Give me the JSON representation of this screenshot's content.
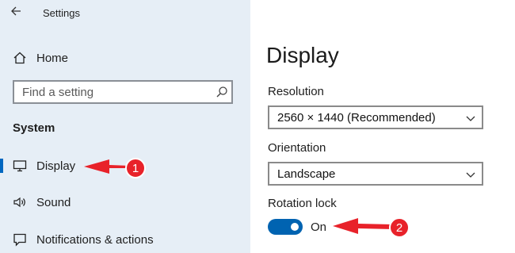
{
  "window": {
    "title": "Settings"
  },
  "sidebar": {
    "home_label": "Home",
    "search": {
      "placeholder": "Find a setting"
    },
    "section_title": "System",
    "items": [
      {
        "label": "Display",
        "icon": "monitor-icon",
        "active": true
      },
      {
        "label": "Sound",
        "icon": "speaker-icon",
        "active": false
      },
      {
        "label": "Notifications & actions",
        "icon": "notification-icon",
        "active": false
      }
    ]
  },
  "main": {
    "title": "Display",
    "resolution": {
      "label": "Resolution",
      "value": "2560 × 1440 (Recommended)"
    },
    "orientation": {
      "label": "Orientation",
      "value": "Landscape"
    },
    "rotation_lock": {
      "label": "Rotation lock",
      "state": "On"
    }
  },
  "annotations": [
    {
      "number": "1"
    },
    {
      "number": "2"
    }
  ],
  "colors": {
    "sidebar_bg": "#e6eef6",
    "accent": "#0063b1",
    "annotation_red": "#e8222a"
  }
}
